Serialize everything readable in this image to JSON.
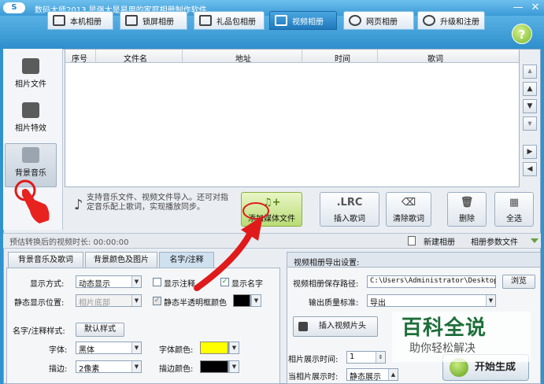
{
  "titlebar": {
    "logo": "S",
    "title": "数码大师2013   是强大是易用的家庭相册制作软件"
  },
  "tabs": [
    {
      "label": "本机相册",
      "active": false
    },
    {
      "label": "锁屏相册",
      "active": false
    },
    {
      "label": "礼品包相册",
      "active": false
    },
    {
      "label": "视频相册",
      "active": true
    },
    {
      "label": "网页相册",
      "active": false
    },
    {
      "label": "升级和注册",
      "active": false
    }
  ],
  "sidebar": {
    "items": [
      {
        "label": "相片文件"
      },
      {
        "label": "相片特效"
      },
      {
        "label": "背景音乐",
        "active": true
      }
    ]
  },
  "table": {
    "columns": [
      "序号",
      "文件名",
      "地址",
      "时间",
      "歌词"
    ],
    "rows": []
  },
  "info_text": "支持音乐文件、视频文件导入。还可对指定音乐配上歌词，实现播放同步。",
  "actions": {
    "add_media": "添加媒体文件",
    "lrc_icon": ".LRC",
    "insert_lyrics": "插入歌词",
    "clear_lyrics": "清除歌词",
    "delete": "删除",
    "select_all": "全选"
  },
  "status": {
    "duration": "预估转换后的视频时长: 00:00:00",
    "new_album": "新建相册",
    "album_params": "相册参数文件"
  },
  "bottom_tabs": [
    {
      "label": "背景音乐及歌词",
      "active": false
    },
    {
      "label": "背景颜色及图片",
      "active": false
    },
    {
      "label": "名字/注释",
      "active": true
    }
  ],
  "name_panel": {
    "display_mode_label": "显示方式:",
    "display_mode_value": "动态显示",
    "show_note_label": "显示注释",
    "show_name_label": "显示名字",
    "static_pos_label": "静态显示位置:",
    "static_pos_value": "相片底部",
    "static_opacity_label": "静态半透明框颜色",
    "style_label": "名字/注释样式:",
    "default_style_btn": "默认样式",
    "font_label": "字体:",
    "font_value": "黑体",
    "font_color_label": "字体颜色:",
    "border_label": "描边:",
    "border_value": "2像素",
    "border_color_label": "描边颜色:",
    "font_color": "#ffff00",
    "border_color": "#000000",
    "opacity_color": "#000000"
  },
  "export_panel": {
    "header": "视频相册导出设置:",
    "save_path_label": "视频相册保存路径:",
    "save_path_value": "C:\\Users\\Administrator\\Desktop",
    "browse_btn": "浏览",
    "quality_label": "输出质量标准:",
    "quality_value": "导出",
    "insert_intro_btn": "插入视频片头",
    "photo_time_label": "相片展示时间:",
    "photo_time_value": "1",
    "photo_display_label": "当相片展示时:",
    "photo_display_value": "静态展示",
    "start_btn": "开始生成"
  },
  "watermark": {
    "main": "百科全说",
    "sub": "助你轻松解决"
  }
}
